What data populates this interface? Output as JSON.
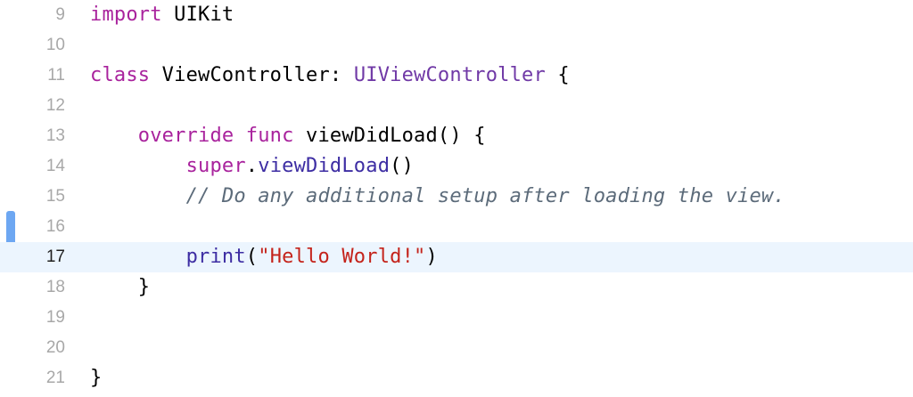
{
  "editor": {
    "current_line": "17",
    "colors": {
      "keyword": "#a9239d",
      "type": "#7039a6",
      "function": "#3d2da3",
      "string": "#c4231b",
      "comment": "#5c6b7a",
      "current_line_background": "#ecf5fe",
      "change_bar": "#6da7f2"
    },
    "lines": [
      {
        "number": "9",
        "tokens": {
          "kw": "import",
          "sp": " ",
          "name": "UIKit"
        }
      },
      {
        "number": "10"
      },
      {
        "number": "11",
        "tokens": {
          "kw": "class",
          "name": " ViewController: ",
          "type": "UIViewController",
          "brace": " {"
        }
      },
      {
        "number": "12"
      },
      {
        "number": "13",
        "tokens": {
          "indent": "    ",
          "kw1": "override",
          "sp": " ",
          "kw2": "func",
          "name": " viewDidLoad() {"
        }
      },
      {
        "number": "14",
        "tokens": {
          "indent": "        ",
          "kw": "super",
          "dot": ".",
          "fn": "viewDidLoad",
          "paren": "()"
        }
      },
      {
        "number": "15",
        "tokens": {
          "indent": "        ",
          "comment": "// Do any additional setup after loading the view."
        }
      },
      {
        "number": "16"
      },
      {
        "number": "17",
        "tokens": {
          "indent": "        ",
          "fn": "print",
          "open": "(",
          "str": "\"Hello World!\"",
          "close": ")"
        }
      },
      {
        "number": "18",
        "tokens": {
          "indent": "    ",
          "brace": "}"
        }
      },
      {
        "number": "19"
      },
      {
        "number": "20"
      },
      {
        "number": "21",
        "tokens": {
          "brace": "}"
        }
      }
    ]
  }
}
